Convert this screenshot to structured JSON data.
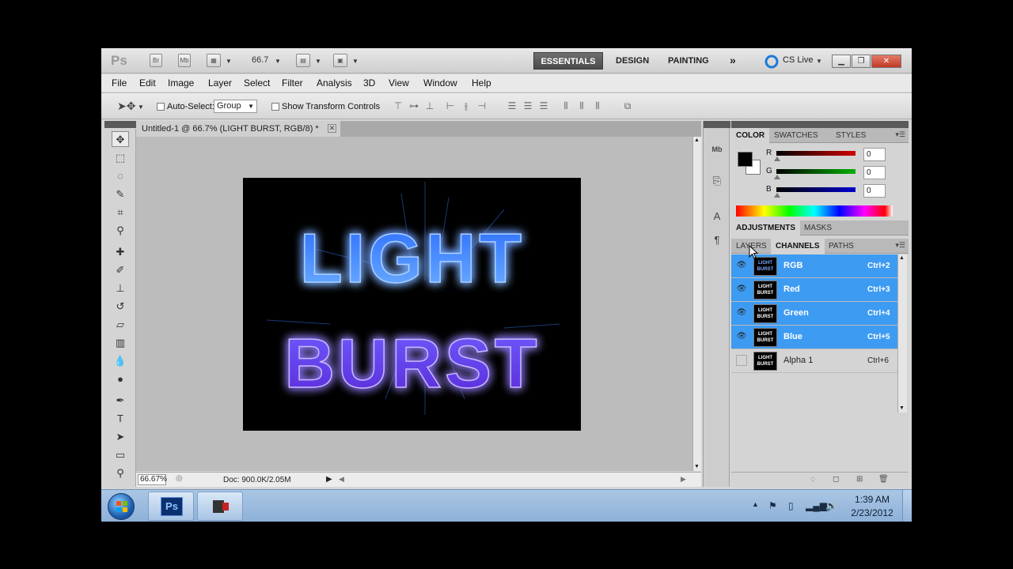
{
  "appbar": {
    "logo": "Ps",
    "btn_bridge": "Br",
    "btn_minibridge": "Mb",
    "zoom": "66.7",
    "workspaces": {
      "active": "ESSENTIALS",
      "design": "DESIGN",
      "painting": "PAINTING",
      "more": "»"
    },
    "cs_live": "CS Live"
  },
  "menu": [
    "File",
    "Edit",
    "Image",
    "Layer",
    "Select",
    "Filter",
    "Analysis",
    "3D",
    "View",
    "Window",
    "Help"
  ],
  "options": {
    "auto_select_label": "Auto-Select:",
    "auto_select_value": "Group",
    "transform_label": "Show Transform Controls"
  },
  "document": {
    "tab_title": "Untitled-1 @ 66.7% (LIGHT BURST, RGB/8) *",
    "art_line1": "LIGHT",
    "art_line2": "BURST",
    "status_zoom": "66.67%",
    "status_doc": "Doc: 900.0K/2.05M"
  },
  "panels": {
    "color_tabs": [
      "COLOR",
      "SWATCHES",
      "STYLES"
    ],
    "sliders": [
      {
        "label": "R",
        "value": "0",
        "color": "#d00000"
      },
      {
        "label": "G",
        "value": "0",
        "color": "#00b000"
      },
      {
        "label": "B",
        "value": "0",
        "color": "#0000d0"
      }
    ],
    "adj_tabs": [
      "ADJUSTMENTS",
      "MASKS"
    ],
    "layer_tabs": [
      "LAYERS",
      "CHANNELS",
      "PATHS"
    ],
    "channels": [
      {
        "name": "RGB",
        "shortcut": "Ctrl+2",
        "visible": true,
        "selected": true
      },
      {
        "name": "Red",
        "shortcut": "Ctrl+3",
        "visible": true,
        "selected": true
      },
      {
        "name": "Green",
        "shortcut": "Ctrl+4",
        "visible": true,
        "selected": true
      },
      {
        "name": "Blue",
        "shortcut": "Ctrl+5",
        "visible": true,
        "selected": true
      },
      {
        "name": "Alpha 1",
        "shortcut": "Ctrl+6",
        "visible": false,
        "selected": false
      }
    ],
    "thumb_text1": "LIGHT",
    "thumb_text2": "BURST",
    "accent": "#3d9bf2"
  },
  "taskbar": {
    "ps_label": "Ps",
    "time": "1:39 AM",
    "date": "2/23/2012"
  }
}
